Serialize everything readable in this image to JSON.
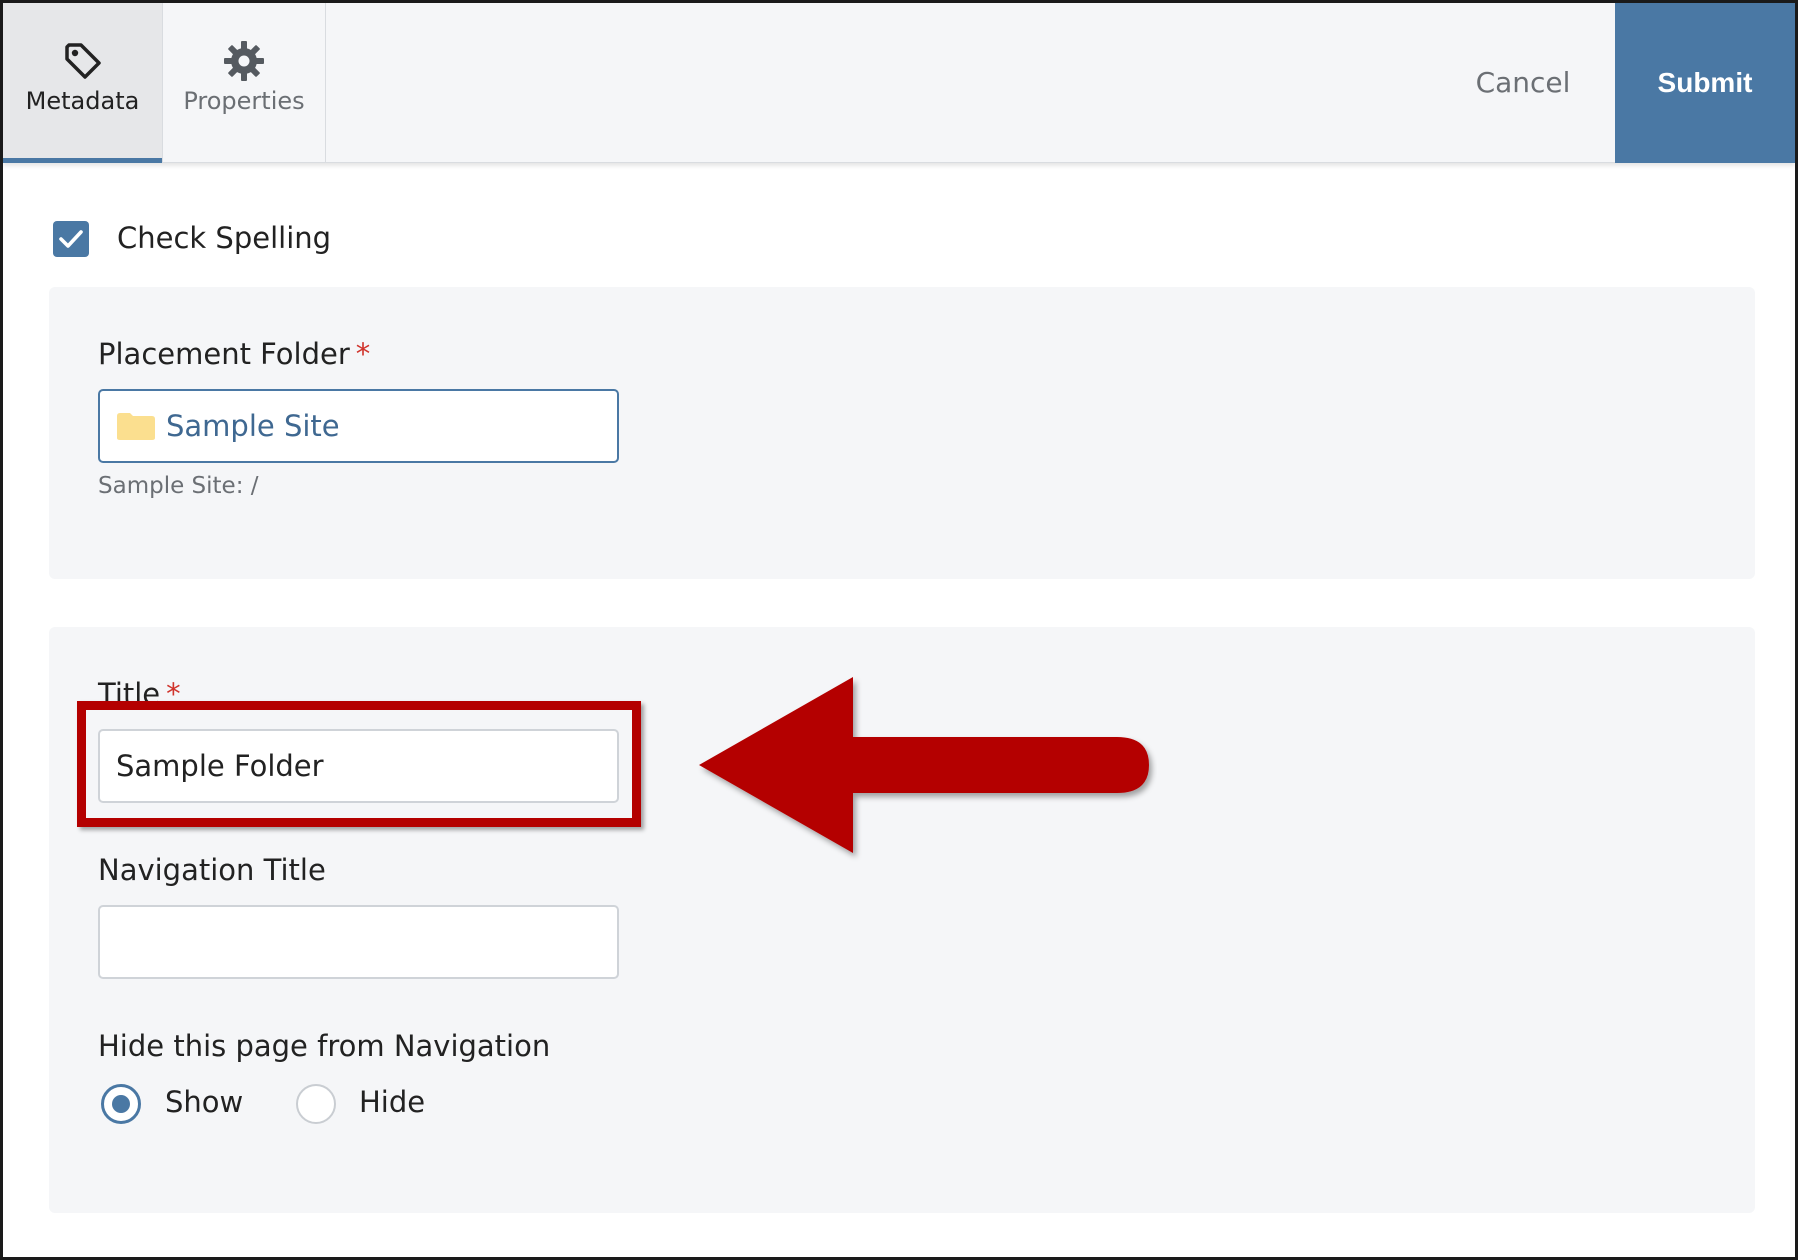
{
  "tabs": [
    {
      "label": "Metadata",
      "icon": "tag-icon",
      "active": true
    },
    {
      "label": "Properties",
      "icon": "gear-icon",
      "active": false
    }
  ],
  "actions": {
    "cancel_label": "Cancel",
    "submit_label": "Submit"
  },
  "check_spelling": {
    "label": "Check Spelling",
    "checked": true
  },
  "placement": {
    "label": "Placement Folder",
    "required_marker": "*",
    "value": "Sample Site",
    "helper": "Sample Site: /"
  },
  "title_field": {
    "label": "Title",
    "required_marker": "*",
    "value": "Sample Folder"
  },
  "nav_title": {
    "label": "Navigation Title",
    "value": ""
  },
  "hide_nav": {
    "label": "Hide this page from Navigation",
    "options": [
      {
        "label": "Show",
        "selected": true
      },
      {
        "label": "Hide",
        "selected": false
      }
    ]
  },
  "colors": {
    "accent": "#4a78a4",
    "required": "#d0342c",
    "annotation": "#b40000",
    "folder": "#fbdf8f"
  }
}
